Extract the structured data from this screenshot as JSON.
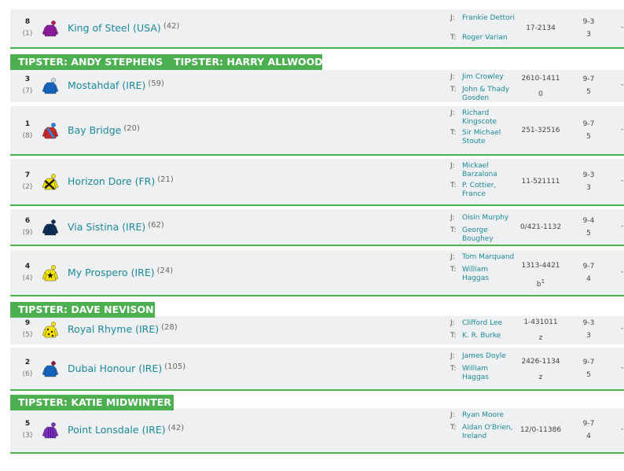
{
  "top_fragment": "...  |  |  |  .. |",
  "rows": [
    {
      "num": "8",
      "draw": "(1)",
      "horse": "King of Steel (USA)",
      "rating": "(42)",
      "j_label": "J:",
      "jockey": "Frankie Dettori",
      "t_label": "T:",
      "trainer": "Roger Varian",
      "form": "17-2134",
      "form_sub": "",
      "weight": "9-3",
      "age": "3",
      "dash": "-",
      "silk": {
        "body": "#8b1a9c",
        "sleeve": "#8b1a9c",
        "cap": "#c2185b",
        "pattern": "none"
      }
    },
    {
      "num": "3",
      "draw": "(7)",
      "horse": "Mostahdaf (IRE)",
      "rating": "(59)",
      "j_label": "J:",
      "jockey": "Jim Crowley",
      "t_label": "T:",
      "trainer": "John & Thady Gosden",
      "form": "2610-1411",
      "form_sub": "0",
      "weight": "9-7",
      "age": "5",
      "dash": "-",
      "silk": {
        "body": "#1565c0",
        "sleeve": "#1565c0",
        "cap": "#bbdefb",
        "pattern": "none"
      }
    },
    {
      "num": "1",
      "draw": "(8)",
      "horse": "Bay Bridge",
      "rating": "(20)",
      "j_label": "J:",
      "jockey": "Richard Kingscote",
      "t_label": "T:",
      "trainer": "Sir Michael Stoute",
      "form": "251-32516",
      "form_sub": "",
      "weight": "9-7",
      "age": "5",
      "dash": "-",
      "silk": {
        "body": "#c62828",
        "sleeve": "#c62828",
        "cap": "#1e88e5",
        "pattern": "sash"
      }
    },
    {
      "num": "7",
      "draw": "(2)",
      "horse": "Horizon Dore (FR)",
      "rating": "(21)",
      "j_label": "J:",
      "jockey": "Mickael Barzalona",
      "t_label": "T:",
      "trainer": "P. Cottier, France",
      "form": "11-521111",
      "form_sub": "",
      "weight": "9-3",
      "age": "3",
      "dash": "-",
      "silk": {
        "body": "#f5e000",
        "sleeve": "#f5e000",
        "cap": "#f5e000",
        "pattern": "cross"
      }
    },
    {
      "num": "6",
      "draw": "(9)",
      "horse": "Via Sistina (IRE)",
      "rating": "(62)",
      "j_label": "J:",
      "jockey": "Oisin Murphy",
      "t_label": "T:",
      "trainer": "George Boughey",
      "form": "0/421-1132",
      "form_sub": "",
      "weight": "9-4",
      "age": "5",
      "dash": "-",
      "silk": {
        "body": "#0d2c54",
        "sleeve": "#0d2c54",
        "cap": "#0d2c54",
        "pattern": "none"
      }
    },
    {
      "num": "4",
      "draw": "(4)",
      "horse": "My Prospero (IRE)",
      "rating": "(24)",
      "j_label": "J:",
      "jockey": "Tom Marquand",
      "t_label": "T:",
      "trainer": "William Haggas",
      "form": "1313-4421",
      "form_sub": "b",
      "form_sup": "1",
      "weight": "9-7",
      "age": "4",
      "dash": "-",
      "silk": {
        "body": "#f5e000",
        "sleeve": "#f5e000",
        "cap": "#f5e000",
        "pattern": "star"
      }
    },
    {
      "num": "9",
      "draw": "(5)",
      "horse": "Royal Rhyme (IRE)",
      "rating": "(28)",
      "j_label": "J:",
      "jockey": "Clifford Lee",
      "t_label": "T:",
      "trainer": "K. R. Burke",
      "form": "1-431011",
      "form_sub": "z",
      "weight": "9-3",
      "age": "3",
      "dash": "-",
      "silk": {
        "body": "#f5e000",
        "sleeve": "#f5e000",
        "cap": "#f5e000",
        "pattern": "diamonds"
      }
    },
    {
      "num": "2",
      "draw": "(6)",
      "horse": "Dubai Honour (IRE)",
      "rating": "(105)",
      "j_label": "J:",
      "jockey": "James Doyle",
      "t_label": "T:",
      "trainer": "William Haggas",
      "form": "2426-1134",
      "form_sub": "z",
      "weight": "9-7",
      "age": "5",
      "dash": "-",
      "silk": {
        "body": "#1565c0",
        "sleeve": "#1565c0",
        "cap": "#8b1a3a",
        "pattern": "none"
      }
    },
    {
      "num": "5",
      "draw": "(3)",
      "horse": "Point Lonsdale (IRE)",
      "rating": "(42)",
      "j_label": "J:",
      "jockey": "Ryan Moore",
      "t_label": "T:",
      "trainer": "Aidan O'Brien, Ireland",
      "form": "12/0-11386",
      "form_sub": "",
      "weight": "9-7",
      "age": "4",
      "dash": "-",
      "silk": {
        "body": "#7b2fbf",
        "sleeve": "#7b2fbf",
        "cap": "#7b2fbf",
        "pattern": "stripes"
      }
    }
  ],
  "banners": [
    {
      "labels": [
        "TIPSTER: ANDY STEPHENS",
        "TIPSTER: HARRY ALLWOOD"
      ]
    },
    {
      "labels": [
        "TIPSTER: DAVE NEVISON"
      ]
    },
    {
      "labels": [
        "TIPSTER: KATIE MIDWINTER"
      ]
    }
  ],
  "colors": {
    "accent_green": "#4caf50",
    "link_teal": "#1c8a9a",
    "row_bg": "#eef0f1"
  }
}
